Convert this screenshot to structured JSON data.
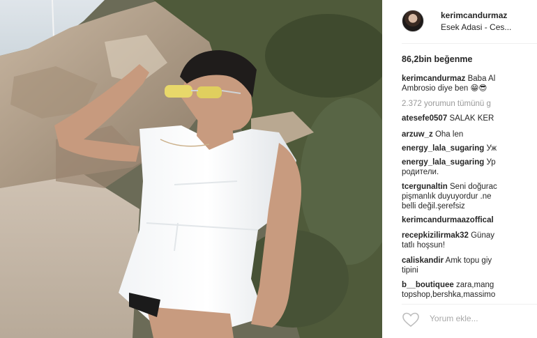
{
  "post": {
    "username": "kerimcandurmaz",
    "location": "Esek Adasi - Ces...",
    "likes": "86,2bin beğenme",
    "caption": {
      "user": "kerimcandurmaz",
      "line1": "Baba Al",
      "line2": "Ambrosio diye ben 😁😎"
    },
    "view_all": "2.372 yorumun tümünü g"
  },
  "comments": [
    {
      "user": "atesefe0507",
      "text": "SALAK KER",
      "cont": ""
    },
    {
      "user": "arzuw_z",
      "text": "Oha len",
      "cont": ""
    },
    {
      "user": "energy_lala_sugaring",
      "text": "Уж",
      "cont": ""
    },
    {
      "user": "energy_lala_sugaring",
      "text": "Ур",
      "cont": "родители."
    },
    {
      "user": "tcergunaltin",
      "text": "Seni doğurac",
      "cont": "pişmanlık duyuyordur .ne",
      "cont2": "belli değil.şerefsiz"
    },
    {
      "user": "kerimcandurmaazoffical",
      "text": "",
      "cont": ""
    },
    {
      "user": "recepkizilirmak32",
      "text": "Günay",
      "cont": "tatlı hoşsun!"
    },
    {
      "user": "caliskandir",
      "text": "Amk topu giy",
      "cont": "tipini"
    },
    {
      "user": "b__boutiquee",
      "text": "zara,mang",
      "cont": "topshop,bershka,massimo"
    }
  ],
  "add_comment_placeholder": "Yorum ekle...",
  "icons": {
    "like": "heart-icon",
    "avatar": "avatar"
  }
}
